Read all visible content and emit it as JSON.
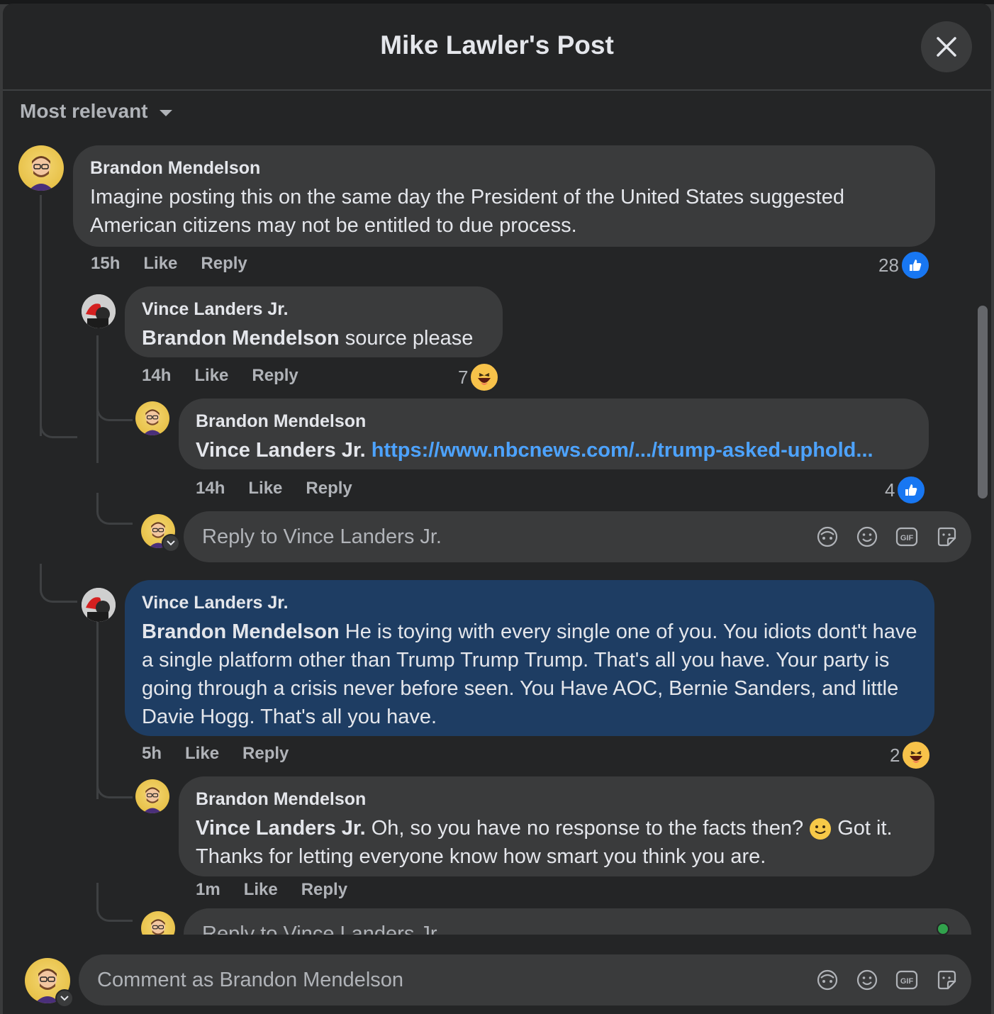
{
  "header": {
    "title": "Mike Lawler's Post"
  },
  "sort": {
    "label": "Most relevant"
  },
  "comments": [
    {
      "author": "Brandon Mendelson",
      "text": "Imagine posting this on the same day the President of the United States suggested American citizens may not be entitled to due process.",
      "time": "15h",
      "like": "Like",
      "reply": "Reply",
      "reactions": "28",
      "reaction_type": "like"
    },
    {
      "author": "Vince Landers Jr.",
      "mention": "Brandon Mendelson",
      "text": " source please",
      "time": "14h",
      "like": "Like",
      "reply": "Reply",
      "reactions": "7",
      "reaction_type": "haha"
    },
    {
      "author": "Brandon Mendelson",
      "mention": "Vince Landers Jr.",
      "link": "https://www.nbcnews.com/.../trump-asked-uphold...",
      "time": "14h",
      "like": "Like",
      "reply": "Reply",
      "reactions": "4",
      "reaction_type": "like"
    },
    {
      "author": "Vince Landers Jr.",
      "mention": "Brandon Mendelson",
      "text": " He is toying with every single one of you. You idiots dont't have a single platform other than Trump Trump Trump. That's all you have. Your party is going through a crisis never before seen. You Have AOC, Bernie Sanders, and little Davie Hogg. That's all you have.",
      "time": "5h",
      "like": "Like",
      "reply": "Reply",
      "reactions": "2",
      "reaction_type": "haha"
    },
    {
      "author": "Brandon Mendelson",
      "mention": "Vince Landers Jr.",
      "text_a": " Oh, so you have no response to the facts then? ",
      "text_b": " Got it. Thanks for letting everyone know how smart you think you are.",
      "time": "1m",
      "like": "Like",
      "reply": "Reply"
    }
  ],
  "reply_boxes": [
    {
      "placeholder": "Reply to Vince Landers Jr."
    },
    {
      "placeholder": "Reply to Vince Landers Jr."
    }
  ],
  "composer": {
    "placeholder": "Comment as Brandon Mendelson"
  },
  "tools": [
    "avatar-sticker-icon",
    "emoji-icon",
    "gif-icon",
    "sticker-icon"
  ],
  "tool_gif_label": "GIF",
  "colors": {
    "like_blue": "#1877f2",
    "highlight": "#1e3d63",
    "link": "#4da3ff"
  }
}
